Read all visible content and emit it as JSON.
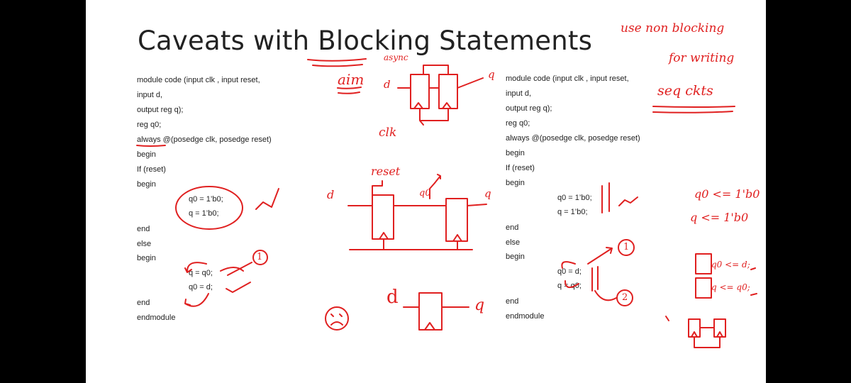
{
  "slide": {
    "title": "Caveats with Blocking Statements"
  },
  "left_code": [
    "module code (input clk , input reset,",
    "input d,",
    "output reg q);",
    "reg q0;",
    "always @(posedge clk, posedge reset)",
    "begin",
    "If (reset)",
    "begin",
    "q0 = 1’b0;",
    "q = 1’b0;",
    "end",
    "else",
    "begin",
    "q = q0;",
    "q0 = d;",
    "end",
    "endmodule"
  ],
  "right_code": [
    "module code (input clk , input reset,",
    "input d,",
    "output reg q);",
    "reg q0;",
    "always @(posedge clk, posedge reset)",
    "begin",
    "If (reset)",
    "begin",
    "q0 = 1’b0;",
    "q = 1’b0;",
    "end",
    "else",
    "begin",
    "q0 = d;",
    "q = q0;",
    "end",
    "endmodule"
  ],
  "annotations": {
    "note_line1": "use non blocking",
    "note_line2": "for writing",
    "note_line3": "seq ckts",
    "aim": "aim",
    "async": "async",
    "clk": "clk",
    "reset": "reset",
    "q0": "q0",
    "d": "d",
    "q": "q",
    "one": "1",
    "two": "2",
    "nb1": "q0 <= 1'b0",
    "nb2": "q <= 1'b0",
    "nb3": "q0 <= d;",
    "nb4": "q <= q0;"
  },
  "colors": {
    "ink": "#e02020",
    "background": "#000000",
    "slide": "#ffffff"
  }
}
